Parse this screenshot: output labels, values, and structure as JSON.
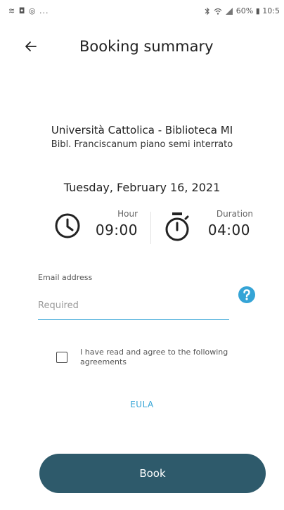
{
  "status_bar": {
    "left_icons": "≋ ◘ ◎ ...",
    "right_text": "60% ▮ 10:5"
  },
  "header": {
    "title": "Booking summary",
    "back_icon": "arrow-left-icon"
  },
  "venue": {
    "name": "Università Cattolica - Biblioteca MI",
    "location": "Bibl. Franciscanum piano semi interrato"
  },
  "date": "Tuesday, February 16, 2021",
  "hour": {
    "label": "Hour",
    "value": "09:00",
    "icon": "clock-icon"
  },
  "duration": {
    "label": "Duration",
    "value": "04:00",
    "icon": "stopwatch-icon"
  },
  "email": {
    "label": "Email address",
    "placeholder": "Required",
    "value": ""
  },
  "help_icon": "question-circle-icon",
  "agreement": {
    "text": "I have read and agree to the following agreements",
    "checked": false
  },
  "eula_label": "EULA",
  "book_label": "Book",
  "colors": {
    "accent": "#35a4d6",
    "button": "#2e5a6b"
  }
}
